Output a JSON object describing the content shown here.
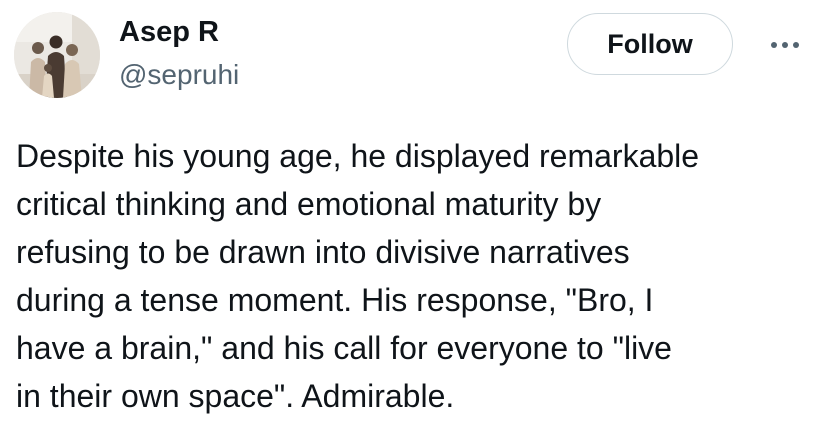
{
  "tweet": {
    "author": {
      "display_name": "Asep R",
      "handle": "@sepruhi",
      "avatar_icon": "profile-photo"
    },
    "follow_label": "Follow",
    "more_icon": "ellipsis-icon",
    "text": "Despite his young age, he displayed remarkable\ncritical thinking and emotional maturity by\nrefusing to be drawn into divisive narratives\nduring a tense moment. His response, \"Bro, I\nhave a brain,\" and his call for everyone to \"live\nin their own space\". Admirable."
  },
  "colors": {
    "text_primary": "#0f1419",
    "text_secondary": "#536471",
    "button_border": "#cfd9de",
    "background": "#ffffff"
  }
}
